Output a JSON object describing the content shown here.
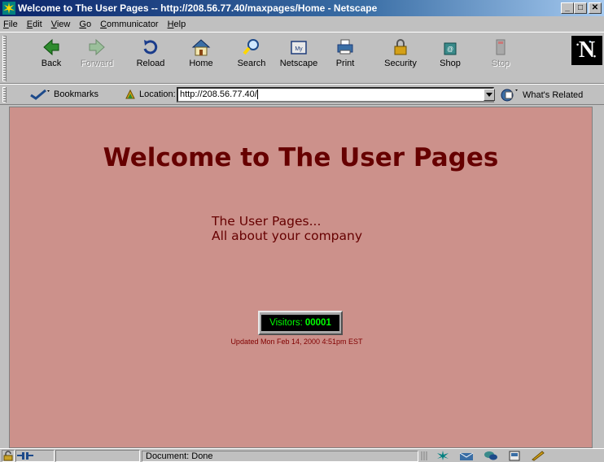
{
  "window": {
    "title": "Welcome to The User Pages -- http://208.56.77.40/maxpages/Home - Netscape",
    "controls": {
      "minimize": "_",
      "maximize": "□",
      "close": "✕"
    }
  },
  "menu": [
    "File",
    "Edit",
    "View",
    "Go",
    "Communicator",
    "Help"
  ],
  "toolbar": {
    "back": "Back",
    "forward": "Forward",
    "reload": "Reload",
    "home": "Home",
    "search": "Search",
    "netscape": "Netscape",
    "print": "Print",
    "security": "Security",
    "shop": "Shop",
    "stop": "Stop",
    "logo": "N"
  },
  "location_bar": {
    "bookmarks_label": "Bookmarks",
    "location_label": "Location:",
    "url": "http://208.56.77.40/",
    "whats_related": "What's Related"
  },
  "page": {
    "heading": "Welcome to The User Pages",
    "tagline_line1": "The User Pages...",
    "tagline_line2": "All about your company",
    "counter_label": "Visitors:",
    "counter_value": "00001",
    "updated": "Updated Mon Feb 14, 2000 4:51pm EST"
  },
  "status": {
    "text": "Document: Done"
  },
  "colors": {
    "page_background": "#cc918b",
    "heading": "#660000",
    "counter_text": "#00ff00"
  }
}
